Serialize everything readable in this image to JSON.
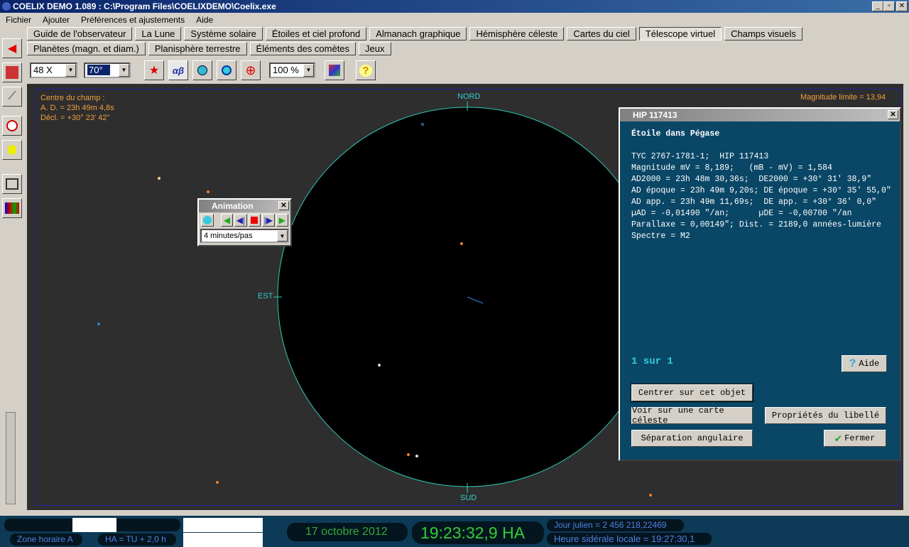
{
  "window": {
    "title": "COELIX DEMO 1.089 : C:\\Program Files\\COELIXDEMO\\Coelix.exe",
    "min": "_",
    "max": "▫",
    "close": "✕"
  },
  "menu": [
    "Fichier",
    "Ajouter",
    "Préférences et ajustements",
    "Aide"
  ],
  "tabs_row1": [
    "Guide de l'observateur",
    "La Lune",
    "Système solaire",
    "Étoiles et ciel profond",
    "Almanach graphique",
    "Hémisphère céleste",
    "Cartes du ciel",
    "Télescope virtuel",
    "Champs visuels"
  ],
  "tabs_row2": [
    "Planètes (magn. et diam.)",
    "Planisphère terrestre",
    "Éléments des comètes",
    "Jeux"
  ],
  "active_tab": "Télescope virtuel",
  "toolbar": {
    "magnification": "48 X",
    "field": "70°",
    "zoom": "100 %",
    "greek_label": "αβ",
    "help": "?"
  },
  "sky": {
    "center_label": "Centre du champ :",
    "ra": "A. D. = 23h 49m 4,8s",
    "dec": "Décl. = +30° 23' 42\"",
    "limit_mag": "Magnitude limite = 13,94",
    "north": "NORD",
    "south": "SUD",
    "east": "EST",
    "colors": {
      "circle": "#30c8b8",
      "labels": "#f0a040"
    }
  },
  "animation": {
    "title": "Animation",
    "step": "4 minutes/pas"
  },
  "info": {
    "title": "HIP 117413",
    "heading": "Étoile dans Pégase",
    "lines": [
      "TYC 2767-1781-1;  HIP 117413",
      "Magnitude mV = 8,189;   (mB - mV) = 1,584",
      "AD2000 = 23h 48m 30,36s;  DE2000 = +30° 31' 38,9\"",
      "AD époque = 23h 49m 9,20s; DE époque = +30° 35' 55,0\"",
      "AD app. = 23h 49m 11,69s;  DE app. = +30° 36' 0,0\"",
      "µAD = -0,01490 \"/an;      µDE = -0,00700 \"/an",
      "Parallaxe = 0,00149\"; Dist. = 2189,0 années-lumière",
      "Spectre = M2"
    ],
    "count": "1 sur 1",
    "help": "Aide",
    "center": "Centrer sur cet objet",
    "map": "Voir sur une carte céleste",
    "props": "Propriétés du libellé",
    "sep": "Séparation angulaire",
    "close": "Fermer"
  },
  "status": {
    "timezone": "Zone horaire A",
    "offset": "HA = TU + 2,0 h",
    "date": "17 octobre 2012",
    "time": "19:23:32,9 HA",
    "julian": "Jour julien = 2 456 218,22469",
    "sidereal": "Heure sidérale locale =  19:27:30,1"
  }
}
